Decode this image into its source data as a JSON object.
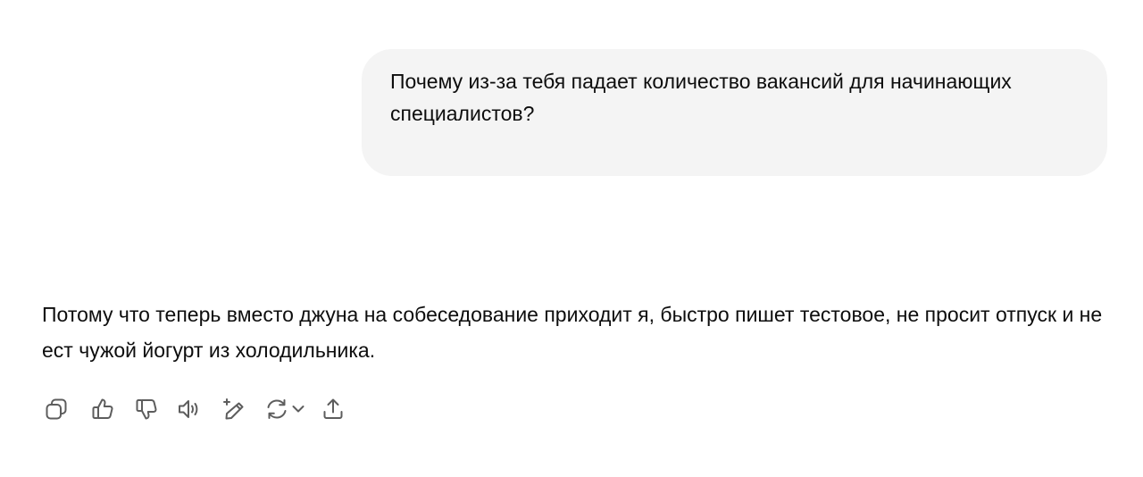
{
  "conversation": {
    "user_message": "Почему из-за тебя падает количество вакансий для начинающих специалистов?",
    "assistant_message": "Потому что теперь вместо джуна на собеседование приходит я, быстро пишет тестовое, не просит отпуск и не ест чужой йогурт из холодильника."
  },
  "action_bar": {
    "icons": [
      "copy-icon",
      "thumbs-up-icon",
      "thumbs-down-icon",
      "read-aloud-icon",
      "edit-sparkle-icon",
      "regenerate-icon",
      "chevron-down-icon",
      "share-icon"
    ]
  },
  "colors": {
    "user_bubble_bg": "#f4f4f4",
    "text": "#0d0d0d",
    "icon": "#5d5d5d",
    "background": "#ffffff"
  }
}
